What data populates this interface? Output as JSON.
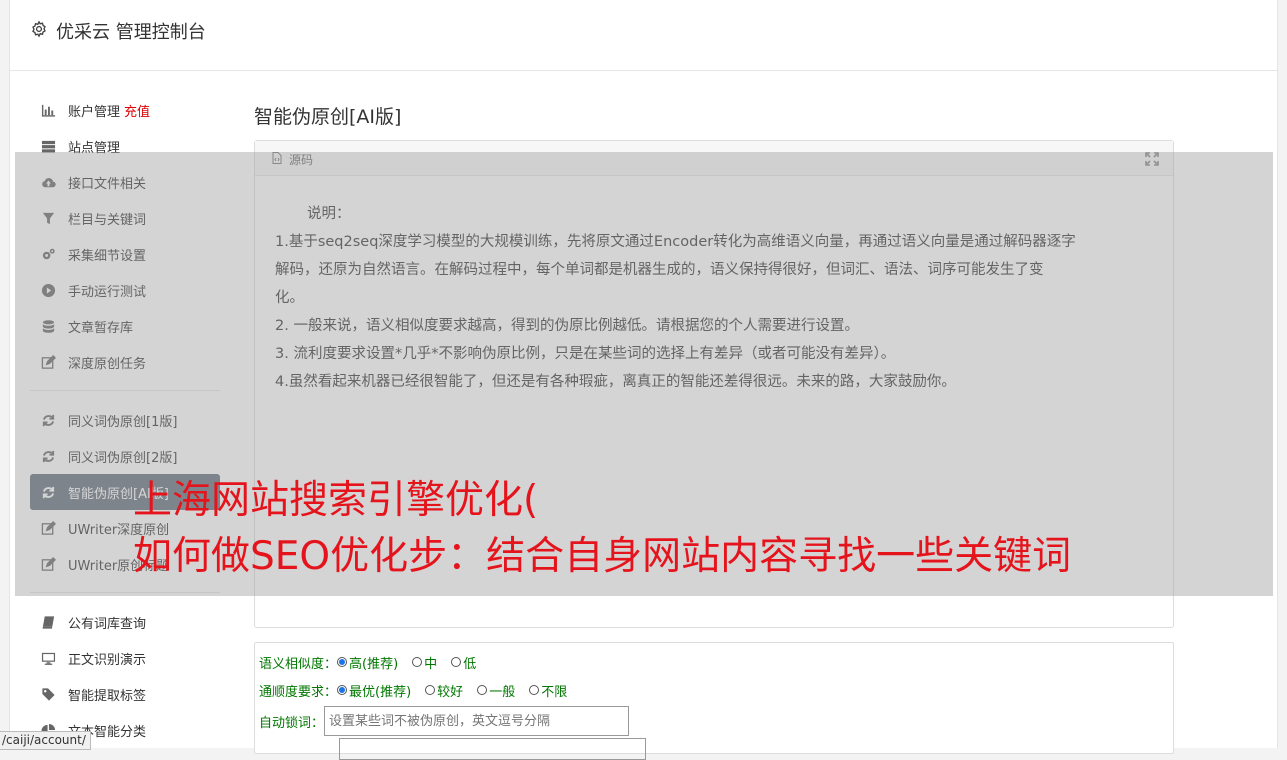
{
  "app": {
    "title": "优采云 管理控制台"
  },
  "sidebar": {
    "group1": [
      {
        "label": "账户管理",
        "extra": "充值",
        "icon": "bar-chart-icon"
      },
      {
        "label": "站点管理",
        "icon": "server-icon"
      },
      {
        "label": "接口文件相关",
        "icon": "cloud-upload-icon"
      },
      {
        "label": "栏目与关键词",
        "icon": "filter-icon"
      },
      {
        "label": "采集细节设置",
        "icon": "gears-icon"
      },
      {
        "label": "手动运行测试",
        "icon": "play-icon"
      },
      {
        "label": "文章暂存库",
        "icon": "database-icon"
      },
      {
        "label": "深度原创任务",
        "icon": "edit-icon"
      }
    ],
    "group2": [
      {
        "label": "同义词伪原创[1版]",
        "icon": "refresh-icon"
      },
      {
        "label": "同义词伪原创[2版]",
        "icon": "refresh-icon"
      },
      {
        "label": "智能伪原创[AI版]",
        "icon": "refresh-icon",
        "active": true
      },
      {
        "label": "UWriter深度原创",
        "icon": "edit-icon"
      },
      {
        "label": "UWriter原创标题",
        "icon": "edit-icon"
      }
    ],
    "group3": [
      {
        "label": "公有词库查询",
        "icon": "book-icon"
      },
      {
        "label": "正文识别演示",
        "icon": "monitor-icon"
      },
      {
        "label": "智能提取标签",
        "icon": "tag-icon"
      },
      {
        "label": "文本智能分类",
        "icon": "pie-chart-icon"
      }
    ]
  },
  "main": {
    "page_title": "智能伪原创[AI版]",
    "editor": {
      "source_label": "源码",
      "lines": [
        "说明：",
        "1.基于seq2seq深度学习模型的大规模训练，先将原文通过Encoder转化为高维语义向量，再通过语义向量是通过解码器逐字",
        "解码，还原为自然语言。在解码过程中，每个单词都是机器生成的，语义保持得很好，但词汇、语法、词序可能发生了变",
        "化。",
        "2. 一般来说，语义相似度要求越高，得到的伪原比例越低。请根据您的个人需要进行设置。",
        "3. 流利度要求设置*几乎*不影响伪原比例，只是在某些词的选择上有差异（或者可能没有差异）。",
        "4.虽然看起来机器已经很智能了，但还是有各种瑕疵，离真正的智能还差得很远。未来的路，大家鼓励你。"
      ]
    },
    "form": {
      "similarity_label": "语义相似度：",
      "similarity_options": [
        "高(推荐)",
        "中",
        "低"
      ],
      "fluency_label": "通顺度要求：",
      "fluency_options": [
        "最优(推荐)",
        "较好",
        "一般",
        "不限"
      ],
      "lock_label": "自动锁词：",
      "lock_placeholder": "设置某些词不被伪原创，英文逗号分隔"
    }
  },
  "overlay": {
    "line1": "上海网站搜索引擎优化(",
    "line2": "如何做SEO优化步：结合自身网站内容寻找一些关键词"
  },
  "statusbar": {
    "url": "/caiji/account/"
  },
  "colors": {
    "accent": "#1a73e8",
    "active_bg": "#636e7b",
    "overlay_text": "#e5141c",
    "form_label": "#007700"
  }
}
